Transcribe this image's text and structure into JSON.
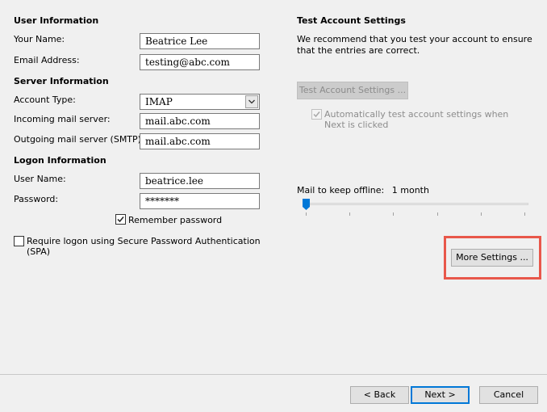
{
  "left": {
    "user_info": {
      "title": "User Information",
      "name_label": "Your Name:",
      "name_value": "Beatrice Lee",
      "email_label": "Email Address:",
      "email_value": "testing@abc.com"
    },
    "server_info": {
      "title": "Server Information",
      "account_type_label": "Account Type:",
      "account_type_value": "IMAP",
      "incoming_label": "Incoming mail server:",
      "incoming_value": "mail.abc.com",
      "outgoing_label": "Outgoing mail server (SMTP):",
      "outgoing_value": "mail.abc.com"
    },
    "logon_info": {
      "title": "Logon Information",
      "username_label": "User Name:",
      "username_value": "beatrice.lee",
      "password_label": "Password:",
      "password_value": "*******",
      "remember_label": "Remember password",
      "remember_checked": true,
      "spa_label": "Require logon using Secure Password Authentication (SPA)",
      "spa_checked": false
    }
  },
  "right": {
    "test_title": "Test Account Settings",
    "test_desc": "We recommend that you test your account to ensure that the entries are correct.",
    "test_button": "Test Account Settings ...",
    "auto_test_label": "Automatically test account settings when Next is clicked",
    "auto_test_checked": true,
    "offline_label": "Mail to keep offline:",
    "offline_value": "1 month",
    "offline_slider_position": 0,
    "more_settings_button": "More Settings ..."
  },
  "footer": {
    "back_button": "< Back",
    "next_button": "Next >",
    "cancel_button": "Cancel"
  },
  "colors": {
    "highlight": "#e8574a",
    "accent": "#0078d7"
  }
}
